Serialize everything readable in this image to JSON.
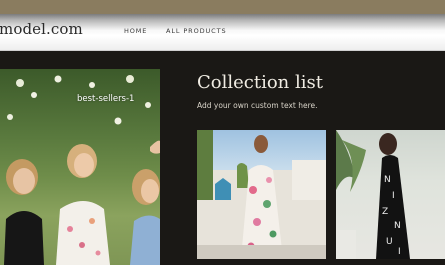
{
  "header": {
    "logo": "model.com",
    "nav": [
      "HOME",
      "ALL PRODUCTS"
    ]
  },
  "hero": {
    "label": "best-sellers-1"
  },
  "collection": {
    "title": "Collection list",
    "subtitle": "Add your own custom text here."
  },
  "colors": {
    "topbar": "#8a7c5f",
    "background": "#1a1815",
    "title_text": "#f0ece3"
  }
}
